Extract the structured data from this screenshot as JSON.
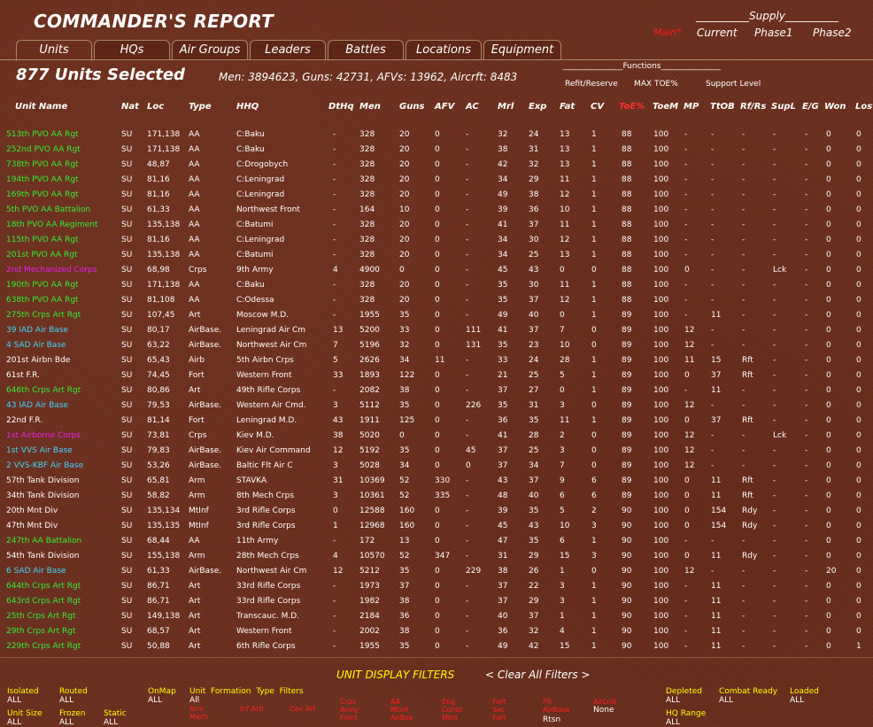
{
  "title": "COMMANDER'S REPORT",
  "tabs": [
    "Units",
    "HQs",
    "Air Groups",
    "Leaders",
    "Battles",
    "Locations",
    "Equipment"
  ],
  "supply": {
    "label": "__________Supply__________",
    "main": "Main*",
    "current": "Current",
    "phase1": "Phase1",
    "phase2": "Phase2"
  },
  "summary": {
    "units_selected": "877 Units Selected",
    "totals": "Men: 3894623, Guns: 42731, AFVs: 13962, Aircrft: 8483"
  },
  "functions": {
    "label": "_______________Functions_______________",
    "refit": "Refit/Reserve",
    "maxtoe": "MAX TOE%",
    "support": "Support Level"
  },
  "columns": [
    "Unit Name",
    "Nat",
    "Loc",
    "Type",
    "HHQ",
    "DtHq",
    "Men",
    "Guns",
    "AFV",
    "AC",
    "Mrl",
    "Exp",
    "Fat",
    "CV",
    "ToE%",
    "ToeM",
    "MP",
    "TtOB",
    "Rf/Rs",
    "SupL",
    "E/G",
    "Won",
    "Lost"
  ],
  "colors": {
    "green": "#33ee33",
    "white": "#ffffff",
    "cyan": "#44d4ff",
    "magenta": "#ee22ee",
    "toe_header": "#ff3030",
    "filter_label": "#ffff00"
  },
  "rows": [
    {
      "name": "513th PVO AA Rgt",
      "color": "green",
      "nat": "SU",
      "loc": "171,138",
      "type": "AA",
      "hhq": "C:Baku",
      "dthq": "-",
      "men": "328",
      "guns": "20",
      "afv": "0",
      "ac": "-",
      "mrl": "32",
      "exp": "24",
      "fat": "13",
      "cv": "1",
      "toe": "88",
      "toem": "100",
      "mp": "-",
      "trob": "-",
      "rfrs": "-",
      "supl": "-",
      "eg": "-",
      "won": "0",
      "lost": "0"
    },
    {
      "name": "252nd PVO AA Rgt",
      "color": "green",
      "nat": "SU",
      "loc": "171,138",
      "type": "AA",
      "hhq": "C:Baku",
      "dthq": "-",
      "men": "328",
      "guns": "20",
      "afv": "0",
      "ac": "-",
      "mrl": "38",
      "exp": "31",
      "fat": "13",
      "cv": "1",
      "toe": "88",
      "toem": "100",
      "mp": "-",
      "trob": "-",
      "rfrs": "-",
      "supl": "-",
      "eg": "-",
      "won": "0",
      "lost": "0"
    },
    {
      "name": "738th PVO AA Rgt",
      "color": "green",
      "nat": "SU",
      "loc": "48,87",
      "type": "AA",
      "hhq": "C:Drogobych",
      "dthq": "-",
      "men": "328",
      "guns": "20",
      "afv": "0",
      "ac": "-",
      "mrl": "42",
      "exp": "32",
      "fat": "13",
      "cv": "1",
      "toe": "88",
      "toem": "100",
      "mp": "-",
      "trob": "-",
      "rfrs": "-",
      "supl": "-",
      "eg": "-",
      "won": "0",
      "lost": "0"
    },
    {
      "name": "194th PVO AA Rgt",
      "color": "green",
      "nat": "SU",
      "loc": "81,16",
      "type": "AA",
      "hhq": "C:Leningrad",
      "dthq": "-",
      "men": "328",
      "guns": "20",
      "afv": "0",
      "ac": "-",
      "mrl": "34",
      "exp": "29",
      "fat": "11",
      "cv": "1",
      "toe": "88",
      "toem": "100",
      "mp": "-",
      "trob": "-",
      "rfrs": "-",
      "supl": "-",
      "eg": "-",
      "won": "0",
      "lost": "0"
    },
    {
      "name": "169th PVO AA Rgt",
      "color": "green",
      "nat": "SU",
      "loc": "81,16",
      "type": "AA",
      "hhq": "C:Leningrad",
      "dthq": "-",
      "men": "328",
      "guns": "20",
      "afv": "0",
      "ac": "-",
      "mrl": "49",
      "exp": "38",
      "fat": "12",
      "cv": "1",
      "toe": "88",
      "toem": "100",
      "mp": "-",
      "trob": "-",
      "rfrs": "-",
      "supl": "-",
      "eg": "-",
      "won": "0",
      "lost": "0"
    },
    {
      "name": "5th PVO AA Battalion",
      "color": "green",
      "nat": "SU",
      "loc": "61,33",
      "type": "AA",
      "hhq": "Northwest Front",
      "dthq": "-",
      "men": "164",
      "guns": "10",
      "afv": "0",
      "ac": "-",
      "mrl": "39",
      "exp": "36",
      "fat": "10",
      "cv": "1",
      "toe": "88",
      "toem": "100",
      "mp": "-",
      "trob": "-",
      "rfrs": "-",
      "supl": "-",
      "eg": "-",
      "won": "0",
      "lost": "0"
    },
    {
      "name": "18th PVO AA Regiment",
      "color": "green",
      "nat": "SU",
      "loc": "135,138",
      "type": "AA",
      "hhq": "C:Batumi",
      "dthq": "-",
      "men": "328",
      "guns": "20",
      "afv": "0",
      "ac": "-",
      "mrl": "41",
      "exp": "37",
      "fat": "11",
      "cv": "1",
      "toe": "88",
      "toem": "100",
      "mp": "-",
      "trob": "-",
      "rfrs": "-",
      "supl": "-",
      "eg": "-",
      "won": "0",
      "lost": "0"
    },
    {
      "name": "115th PVO AA Rgt",
      "color": "green",
      "nat": "SU",
      "loc": "81,16",
      "type": "AA",
      "hhq": "C:Leningrad",
      "dthq": "-",
      "men": "328",
      "guns": "20",
      "afv": "0",
      "ac": "-",
      "mrl": "34",
      "exp": "30",
      "fat": "12",
      "cv": "1",
      "toe": "88",
      "toem": "100",
      "mp": "-",
      "trob": "-",
      "rfrs": "-",
      "supl": "-",
      "eg": "-",
      "won": "0",
      "lost": "0"
    },
    {
      "name": "201st PVO AA Rgt",
      "color": "green",
      "nat": "SU",
      "loc": "135,138",
      "type": "AA",
      "hhq": "C:Batumi",
      "dthq": "-",
      "men": "328",
      "guns": "20",
      "afv": "0",
      "ac": "-",
      "mrl": "34",
      "exp": "25",
      "fat": "13",
      "cv": "1",
      "toe": "88",
      "toem": "100",
      "mp": "-",
      "trob": "-",
      "rfrs": "-",
      "supl": "-",
      "eg": "-",
      "won": "0",
      "lost": "0"
    },
    {
      "name": "2nd Mechanized Corps",
      "color": "magenta",
      "nat": "SU",
      "loc": "68,98",
      "type": "Crps",
      "hhq": "9th Army",
      "dthq": "4",
      "men": "4900",
      "guns": "0",
      "afv": "0",
      "ac": "-",
      "mrl": "45",
      "exp": "43",
      "fat": "0",
      "cv": "0",
      "toe": "88",
      "toem": "100",
      "mp": "0",
      "trob": "-",
      "rfrs": "-",
      "supl": "Lck",
      "eg": "-",
      "won": "0",
      "lost": "0"
    },
    {
      "name": "190th PVO AA Rgt",
      "color": "green",
      "nat": "SU",
      "loc": "171,138",
      "type": "AA",
      "hhq": "C:Baku",
      "dthq": "-",
      "men": "328",
      "guns": "20",
      "afv": "0",
      "ac": "-",
      "mrl": "35",
      "exp": "30",
      "fat": "11",
      "cv": "1",
      "toe": "88",
      "toem": "100",
      "mp": "-",
      "trob": "-",
      "rfrs": "-",
      "supl": "-",
      "eg": "-",
      "won": "0",
      "lost": "0"
    },
    {
      "name": "638th PVO AA Rgt",
      "color": "green",
      "nat": "SU",
      "loc": "81,108",
      "type": "AA",
      "hhq": "C:Odessa",
      "dthq": "-",
      "men": "328",
      "guns": "20",
      "afv": "0",
      "ac": "-",
      "mrl": "35",
      "exp": "37",
      "fat": "12",
      "cv": "1",
      "toe": "88",
      "toem": "100",
      "mp": "-",
      "trob": "-",
      "rfrs": "-",
      "supl": "-",
      "eg": "-",
      "won": "0",
      "lost": "0"
    },
    {
      "name": "275th Crps Art Rgt",
      "color": "green",
      "nat": "SU",
      "loc": "107,45",
      "type": "Art",
      "hhq": "Moscow M.D.",
      "dthq": "-",
      "men": "1955",
      "guns": "35",
      "afv": "0",
      "ac": "-",
      "mrl": "49",
      "exp": "40",
      "fat": "0",
      "cv": "1",
      "toe": "89",
      "toem": "100",
      "mp": "-",
      "trob": "11",
      "rfrs": "-",
      "supl": "-",
      "eg": "-",
      "won": "0",
      "lost": "0"
    },
    {
      "name": "39 IAD Air Base",
      "color": "cyan",
      "nat": "SU",
      "loc": "80,17",
      "type": "AirBase.",
      "hhq": "Leningrad Air Cm",
      "dthq": "13",
      "men": "5200",
      "guns": "33",
      "afv": "0",
      "ac": "111",
      "mrl": "41",
      "exp": "37",
      "fat": "7",
      "cv": "0",
      "toe": "89",
      "toem": "100",
      "mp": "12",
      "trob": "-",
      "rfrs": "-",
      "supl": "-",
      "eg": "-",
      "won": "0",
      "lost": "0"
    },
    {
      "name": "4 SAD Air Base",
      "color": "cyan",
      "nat": "SU",
      "loc": "63,22",
      "type": "AirBase.",
      "hhq": "Northwest Air Cm",
      "dthq": "7",
      "men": "5196",
      "guns": "32",
      "afv": "0",
      "ac": "131",
      "mrl": "35",
      "exp": "23",
      "fat": "10",
      "cv": "0",
      "toe": "89",
      "toem": "100",
      "mp": "12",
      "trob": "-",
      "rfrs": "-",
      "supl": "-",
      "eg": "-",
      "won": "0",
      "lost": "0"
    },
    {
      "name": "201st Airbn Bde",
      "color": "white",
      "nat": "SU",
      "loc": "65,43",
      "type": "Airb",
      "hhq": "5th Airbn Crps",
      "dthq": "5",
      "men": "2626",
      "guns": "34",
      "afv": "11",
      "ac": "-",
      "mrl": "33",
      "exp": "24",
      "fat": "28",
      "cv": "1",
      "toe": "89",
      "toem": "100",
      "mp": "11",
      "trob": "15",
      "rfrs": "Rft",
      "supl": "-",
      "eg": "-",
      "won": "0",
      "lost": "0"
    },
    {
      "name": "61st F.R.",
      "color": "white",
      "nat": "SU",
      "loc": "74,45",
      "type": "Fort",
      "hhq": "Western Front",
      "dthq": "33",
      "men": "1893",
      "guns": "122",
      "afv": "0",
      "ac": "-",
      "mrl": "21",
      "exp": "25",
      "fat": "5",
      "cv": "1",
      "toe": "89",
      "toem": "100",
      "mp": "0",
      "trob": "37",
      "rfrs": "Rft",
      "supl": "-",
      "eg": "-",
      "won": "0",
      "lost": "0"
    },
    {
      "name": "646th Crps Art Rgt",
      "color": "green",
      "nat": "SU",
      "loc": "80,86",
      "type": "Art",
      "hhq": "49th Rifle Corps",
      "dthq": "-",
      "men": "2082",
      "guns": "38",
      "afv": "0",
      "ac": "-",
      "mrl": "37",
      "exp": "27",
      "fat": "0",
      "cv": "1",
      "toe": "89",
      "toem": "100",
      "mp": "-",
      "trob": "11",
      "rfrs": "-",
      "supl": "-",
      "eg": "-",
      "won": "0",
      "lost": "0"
    },
    {
      "name": "43 IAD Air Base",
      "color": "cyan",
      "nat": "SU",
      "loc": "79,53",
      "type": "AirBase.",
      "hhq": "Western Air Cmd.",
      "dthq": "3",
      "men": "5112",
      "guns": "35",
      "afv": "0",
      "ac": "226",
      "mrl": "35",
      "exp": "31",
      "fat": "3",
      "cv": "0",
      "toe": "89",
      "toem": "100",
      "mp": "12",
      "trob": "-",
      "rfrs": "-",
      "supl": "-",
      "eg": "-",
      "won": "0",
      "lost": "0"
    },
    {
      "name": "22nd F.R.",
      "color": "white",
      "nat": "SU",
      "loc": "81,14",
      "type": "Fort",
      "hhq": "Leningrad M.D.",
      "dthq": "43",
      "men": "1911",
      "guns": "125",
      "afv": "0",
      "ac": "-",
      "mrl": "36",
      "exp": "35",
      "fat": "11",
      "cv": "1",
      "toe": "89",
      "toem": "100",
      "mp": "0",
      "trob": "37",
      "rfrs": "Rft",
      "supl": "-",
      "eg": "-",
      "won": "0",
      "lost": "0"
    },
    {
      "name": "1st Airborne Corps",
      "color": "magenta",
      "nat": "SU",
      "loc": "73,81",
      "type": "Crps",
      "hhq": "Kiev M.D.",
      "dthq": "38",
      "men": "5020",
      "guns": "0",
      "afv": "0",
      "ac": "-",
      "mrl": "41",
      "exp": "28",
      "fat": "2",
      "cv": "0",
      "toe": "89",
      "toem": "100",
      "mp": "12",
      "trob": "-",
      "rfrs": "-",
      "supl": "Lck",
      "eg": "-",
      "won": "0",
      "lost": "0"
    },
    {
      "name": "1st VVS Air Base",
      "color": "cyan",
      "nat": "SU",
      "loc": "79,83",
      "type": "AirBase.",
      "hhq": "Kiev Air Command",
      "dthq": "12",
      "men": "5192",
      "guns": "35",
      "afv": "0",
      "ac": "45",
      "mrl": "37",
      "exp": "25",
      "fat": "3",
      "cv": "0",
      "toe": "89",
      "toem": "100",
      "mp": "12",
      "trob": "-",
      "rfrs": "-",
      "supl": "-",
      "eg": "-",
      "won": "0",
      "lost": "0"
    },
    {
      "name": "2 VVS-KBF Air Base",
      "color": "cyan",
      "nat": "SU",
      "loc": "53,26",
      "type": "AirBase.",
      "hhq": "Baltic Flt Air C",
      "dthq": "3",
      "men": "5028",
      "guns": "34",
      "afv": "0",
      "ac": "0",
      "mrl": "37",
      "exp": "34",
      "fat": "7",
      "cv": "0",
      "toe": "89",
      "toem": "100",
      "mp": "12",
      "trob": "-",
      "rfrs": "-",
      "supl": "-",
      "eg": "-",
      "won": "0",
      "lost": "0"
    },
    {
      "name": "57th Tank Division",
      "color": "white",
      "nat": "SU",
      "loc": "65,81",
      "type": "Arm",
      "hhq": "STAVKA",
      "dthq": "31",
      "men": "10369",
      "guns": "52",
      "afv": "330",
      "ac": "-",
      "mrl": "43",
      "exp": "37",
      "fat": "9",
      "cv": "6",
      "toe": "89",
      "toem": "100",
      "mp": "0",
      "trob": "11",
      "rfrs": "Rft",
      "supl": "-",
      "eg": "-",
      "won": "0",
      "lost": "0"
    },
    {
      "name": "34th Tank Division",
      "color": "white",
      "nat": "SU",
      "loc": "58,82",
      "type": "Arm",
      "hhq": "8th Mech Crps",
      "dthq": "3",
      "men": "10361",
      "guns": "52",
      "afv": "335",
      "ac": "-",
      "mrl": "48",
      "exp": "40",
      "fat": "6",
      "cv": "6",
      "toe": "89",
      "toem": "100",
      "mp": "0",
      "trob": "11",
      "rfrs": "Rft",
      "supl": "-",
      "eg": "-",
      "won": "0",
      "lost": "0"
    },
    {
      "name": "20th Mnt Div",
      "color": "white",
      "nat": "SU",
      "loc": "135,134",
      "type": "MtInf",
      "hhq": "3rd Rifle Corps",
      "dthq": "0",
      "men": "12588",
      "guns": "160",
      "afv": "0",
      "ac": "-",
      "mrl": "39",
      "exp": "35",
      "fat": "5",
      "cv": "2",
      "toe": "90",
      "toem": "100",
      "mp": "0",
      "trob": "154",
      "rfrs": "Rdy",
      "supl": "-",
      "eg": "-",
      "won": "0",
      "lost": "0"
    },
    {
      "name": "47th Mnt Div",
      "color": "white",
      "nat": "SU",
      "loc": "135,135",
      "type": "MtInf",
      "hhq": "3rd Rifle Corps",
      "dthq": "1",
      "men": "12968",
      "guns": "160",
      "afv": "0",
      "ac": "-",
      "mrl": "45",
      "exp": "43",
      "fat": "10",
      "cv": "3",
      "toe": "90",
      "toem": "100",
      "mp": "0",
      "trob": "154",
      "rfrs": "Rdy",
      "supl": "-",
      "eg": "-",
      "won": "0",
      "lost": "0"
    },
    {
      "name": "247th AA Battalion",
      "color": "green",
      "nat": "SU",
      "loc": "68,44",
      "type": "AA",
      "hhq": "11th Army",
      "dthq": "-",
      "men": "172",
      "guns": "13",
      "afv": "0",
      "ac": "-",
      "mrl": "47",
      "exp": "35",
      "fat": "6",
      "cv": "1",
      "toe": "90",
      "toem": "100",
      "mp": "-",
      "trob": "-",
      "rfrs": "-",
      "supl": "-",
      "eg": "-",
      "won": "0",
      "lost": "0"
    },
    {
      "name": "54th Tank Division",
      "color": "white",
      "nat": "SU",
      "loc": "155,138",
      "type": "Arm",
      "hhq": "28th Mech Crps",
      "dthq": "4",
      "men": "10570",
      "guns": "52",
      "afv": "347",
      "ac": "-",
      "mrl": "31",
      "exp": "29",
      "fat": "15",
      "cv": "3",
      "toe": "90",
      "toem": "100",
      "mp": "0",
      "trob": "11",
      "rfrs": "Rdy",
      "supl": "-",
      "eg": "-",
      "won": "0",
      "lost": "0"
    },
    {
      "name": "6 SAD Air Base",
      "color": "cyan",
      "nat": "SU",
      "loc": "61,33",
      "type": "AirBase.",
      "hhq": "Northwest Air Cm",
      "dthq": "12",
      "men": "5212",
      "guns": "35",
      "afv": "0",
      "ac": "229",
      "mrl": "38",
      "exp": "26",
      "fat": "1",
      "cv": "0",
      "toe": "90",
      "toem": "100",
      "mp": "12",
      "trob": "-",
      "rfrs": "-",
      "supl": "-",
      "eg": "-",
      "won": "20",
      "lost": "0"
    },
    {
      "name": "644th Crps Art Rgt",
      "color": "green",
      "nat": "SU",
      "loc": "86,71",
      "type": "Art",
      "hhq": "33rd Rifle Corps",
      "dthq": "-",
      "men": "1973",
      "guns": "37",
      "afv": "0",
      "ac": "-",
      "mrl": "37",
      "exp": "22",
      "fat": "3",
      "cv": "1",
      "toe": "90",
      "toem": "100",
      "mp": "-",
      "trob": "11",
      "rfrs": "-",
      "supl": "-",
      "eg": "-",
      "won": "0",
      "lost": "0"
    },
    {
      "name": "643rd Crps Art Rgt",
      "color": "green",
      "nat": "SU",
      "loc": "86,71",
      "type": "Art",
      "hhq": "33rd Rifle Corps",
      "dthq": "-",
      "men": "1982",
      "guns": "38",
      "afv": "0",
      "ac": "-",
      "mrl": "37",
      "exp": "29",
      "fat": "3",
      "cv": "1",
      "toe": "90",
      "toem": "100",
      "mp": "-",
      "trob": "11",
      "rfrs": "-",
      "supl": "-",
      "eg": "-",
      "won": "0",
      "lost": "0"
    },
    {
      "name": "25th Crps Art Rgt",
      "color": "green",
      "nat": "SU",
      "loc": "149,138",
      "type": "Art",
      "hhq": "Transcauc. M.D.",
      "dthq": "-",
      "men": "2184",
      "guns": "36",
      "afv": "0",
      "ac": "-",
      "mrl": "40",
      "exp": "37",
      "fat": "1",
      "cv": "1",
      "toe": "90",
      "toem": "100",
      "mp": "-",
      "trob": "11",
      "rfrs": "-",
      "supl": "-",
      "eg": "-",
      "won": "0",
      "lost": "0"
    },
    {
      "name": "29th Crps Art Rgt",
      "color": "green",
      "nat": "SU",
      "loc": "68,57",
      "type": "Art",
      "hhq": "Western Front",
      "dthq": "-",
      "men": "2002",
      "guns": "38",
      "afv": "0",
      "ac": "-",
      "mrl": "36",
      "exp": "32",
      "fat": "4",
      "cv": "1",
      "toe": "90",
      "toem": "100",
      "mp": "-",
      "trob": "11",
      "rfrs": "-",
      "supl": "-",
      "eg": "-",
      "won": "0",
      "lost": "0"
    },
    {
      "name": "229th Crps Art Rgt",
      "color": "green",
      "nat": "SU",
      "loc": "50,88",
      "type": "Art",
      "hhq": "6th Rifle Corps",
      "dthq": "-",
      "men": "1955",
      "guns": "35",
      "afv": "0",
      "ac": "-",
      "mrl": "49",
      "exp": "42",
      "fat": "15",
      "cv": "1",
      "toe": "90",
      "toem": "100",
      "mp": "-",
      "trob": "11",
      "rfrs": "-",
      "supl": "-",
      "eg": "-",
      "won": "0",
      "lost": "1"
    }
  ],
  "filters": {
    "title": "UNIT DISPLAY FILTERS",
    "clear": "< Clear All Filters >",
    "isolated": {
      "label": "Isolated",
      "value": "ALL"
    },
    "routed": {
      "label": "Routed",
      "value": "ALL"
    },
    "onmap": {
      "label": "OnMap",
      "value": "ALL"
    },
    "unit_formation": {
      "label": "Unit  Formation  Type  Filters",
      "value": "All"
    },
    "unit_size": {
      "label": "Unit Size",
      "value": "ALL"
    },
    "frozen": {
      "label": "Frozen",
      "value": "ALL"
    },
    "static": {
      "label": "Static",
      "value": "ALL"
    },
    "depleted": {
      "label": "Depleted",
      "value": "ALL"
    },
    "combat_ready": {
      "label": "Combat Ready",
      "value": "ALL"
    },
    "loaded": {
      "label": "Loaded",
      "value": "ALL"
    },
    "hq_range": {
      "label": "HQ Range",
      "value": "ALL"
    },
    "airlift": {
      "label": "AirLnd",
      "value": "None"
    },
    "rtsn": "Rtsn",
    "type_options": [
      "Arm Mech",
      "Inf Arb",
      "Cav Art",
      "Crps Army Front",
      "AA Mtinf AirBse",
      "Eng Const Mtnt",
      "Fort Sec Fort",
      "FR AirBase"
    ]
  }
}
